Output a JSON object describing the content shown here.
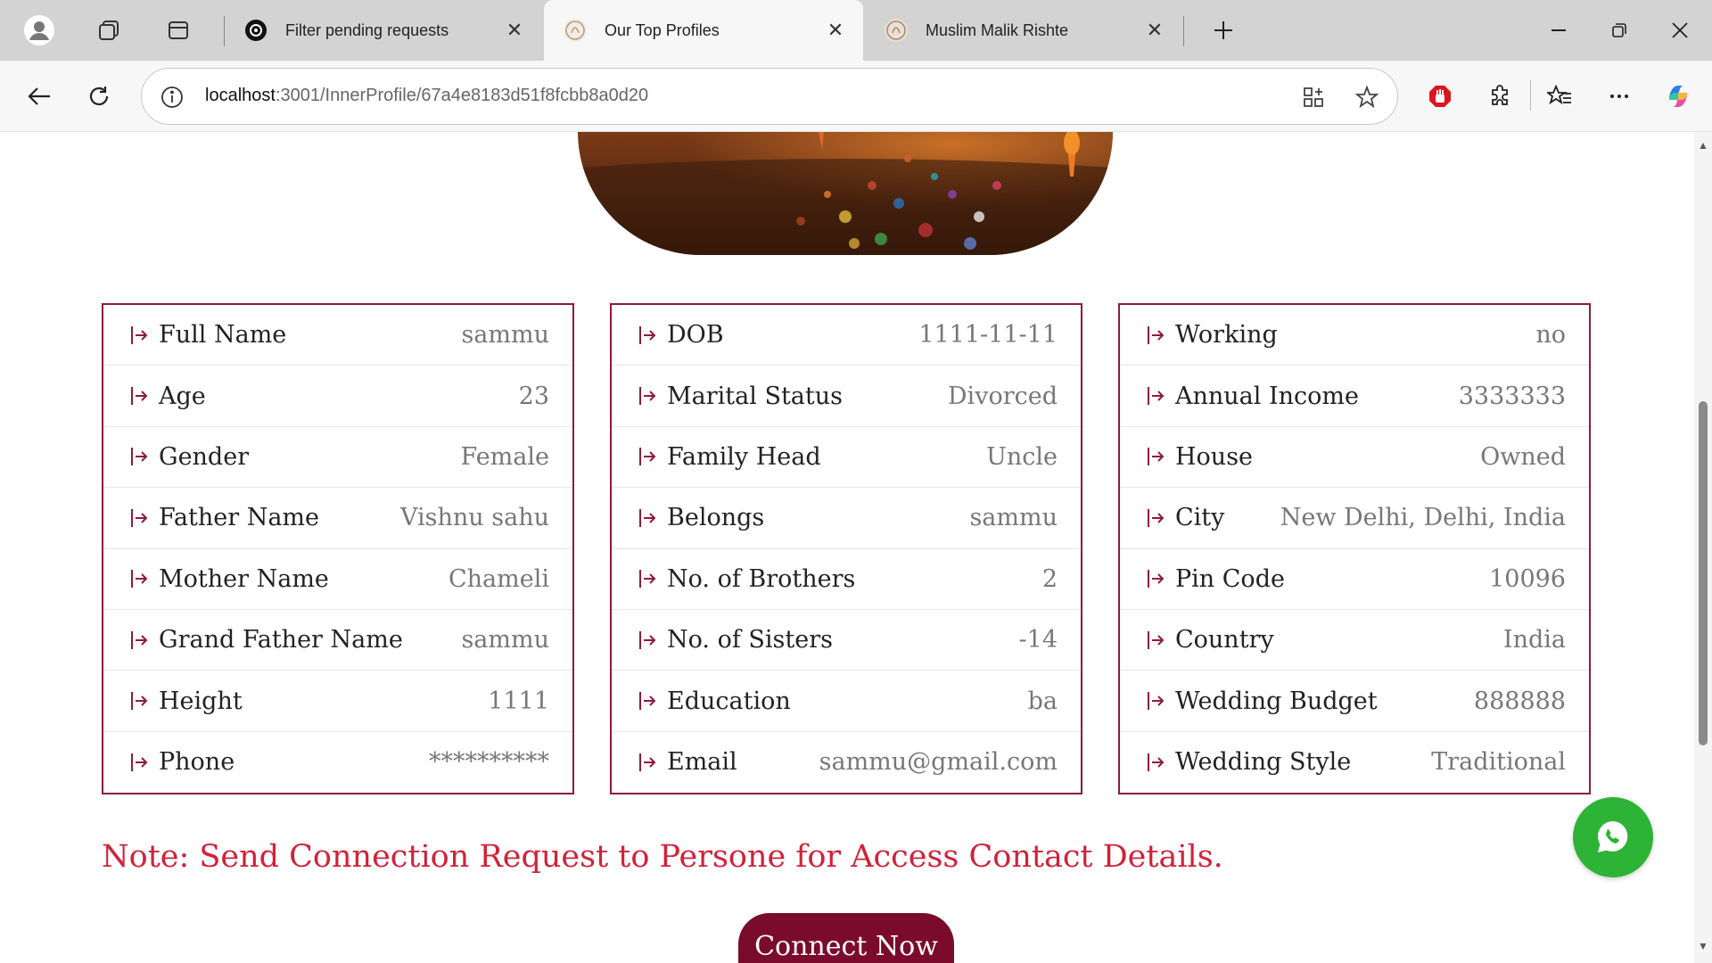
{
  "browser": {
    "tabs": [
      {
        "title": "Filter pending requests",
        "icon": "openai-icon",
        "active": false
      },
      {
        "title": "Our Top Profiles",
        "icon": "site-logo-icon",
        "active": true
      },
      {
        "title": "Muslim Malik Rishte",
        "icon": "site-logo-icon",
        "active": false
      }
    ],
    "url_host": "localhost",
    "url_path": ":3001/InnerProfile/67a4e8183d51f8fcbb8a0d20"
  },
  "profile": {
    "columns": [
      {
        "rows": [
          {
            "label": "Full Name",
            "value": "sammu"
          },
          {
            "label": "Age",
            "value": "23"
          },
          {
            "label": "Gender",
            "value": "Female"
          },
          {
            "label": "Father Name",
            "value": "Vishnu sahu"
          },
          {
            "label": "Mother Name",
            "value": "Chameli"
          },
          {
            "label": "Grand Father Name",
            "value": "sammu"
          },
          {
            "label": "Height",
            "value": "1111"
          },
          {
            "label": "Phone",
            "value": "**********"
          }
        ]
      },
      {
        "rows": [
          {
            "label": "DOB",
            "value": "1111-11-11"
          },
          {
            "label": "Marital Status",
            "value": "Divorced"
          },
          {
            "label": "Family Head",
            "value": "Uncle"
          },
          {
            "label": "Belongs",
            "value": "sammu"
          },
          {
            "label": "No. of Brothers",
            "value": "2"
          },
          {
            "label": "No. of Sisters",
            "value": "-14"
          },
          {
            "label": "Education",
            "value": "ba"
          },
          {
            "label": "Email",
            "value": "sammu@gmail.com"
          }
        ]
      },
      {
        "rows": [
          {
            "label": "Working",
            "value": "no"
          },
          {
            "label": "Annual Income",
            "value": "3333333"
          },
          {
            "label": "House",
            "value": "Owned"
          },
          {
            "label": "City",
            "value": "New Delhi, Delhi, India"
          },
          {
            "label": "Pin Code",
            "value": "10096"
          },
          {
            "label": "Country",
            "value": "India"
          },
          {
            "label": "Wedding Budget",
            "value": "888888"
          },
          {
            "label": "Wedding Style",
            "value": "Traditional"
          }
        ]
      }
    ]
  },
  "note": "Note: Send Connection Request to Persone for Access Contact Details.",
  "connect_label": "Connect Now",
  "colors": {
    "accent": "#8e1a3c",
    "button": "#7b0b2c",
    "note": "#d0223a",
    "whatsapp": "#2db335"
  }
}
